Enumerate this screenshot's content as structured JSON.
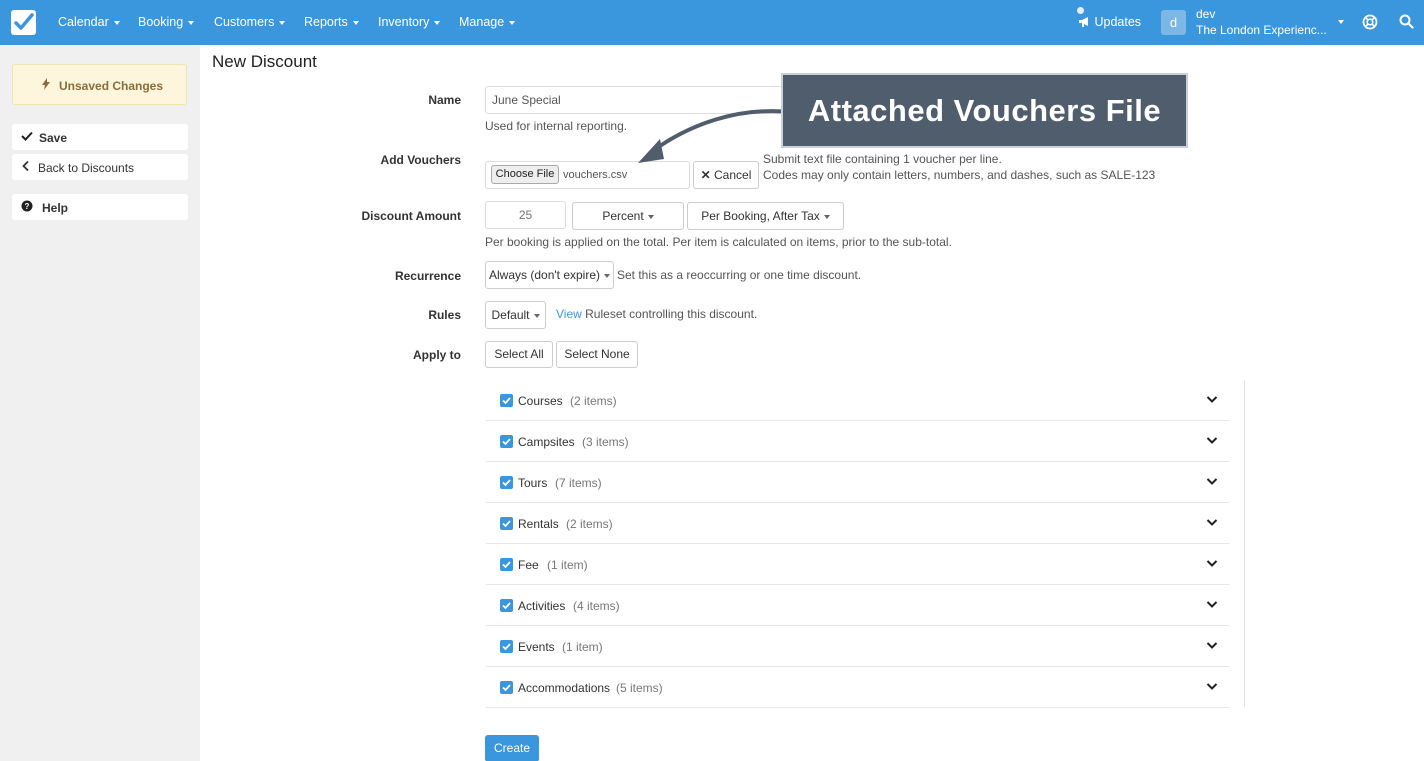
{
  "nav": {
    "items": [
      "Calendar",
      "Booking",
      "Customers",
      "Reports",
      "Inventory",
      "Manage"
    ],
    "updates_label": "Updates",
    "avatar_letter": "d",
    "user_name": "dev",
    "user_org": "The London Experienc..."
  },
  "sidebar": {
    "unsaved_label": "Unsaved Changes",
    "save_label": "Save",
    "back_label": "Back to Discounts",
    "help_label": "Help"
  },
  "page": {
    "title": "New Discount"
  },
  "form": {
    "name_label": "Name",
    "name_value": "June Special",
    "name_help": "Used for internal reporting.",
    "vouchers_label": "Add Vouchers",
    "choose_file_label": "Choose File",
    "file_name": "vouchers.csv",
    "cancel_label": "Cancel",
    "vouchers_help_1": "Submit text file containing 1 voucher per line.",
    "vouchers_help_2": "Codes may only contain letters, numbers, and dashes, such as SALE-123",
    "amount_label": "Discount Amount",
    "amount_value": "25",
    "amount_type": "Percent",
    "amount_scope": "Per Booking, After Tax",
    "amount_help": "Per booking is applied on the total. Per item is calculated on items, prior to the sub-total.",
    "recurrence_label": "Recurrence",
    "recurrence_value": "Always (don't expire)",
    "recurrence_help": "Set this as a reoccurring or one time discount.",
    "rules_label": "Rules",
    "rules_value": "Default",
    "rules_link": "View",
    "rules_help": "Ruleset controlling this discount.",
    "apply_label": "Apply to",
    "select_all_label": "Select All",
    "select_none_label": "Select None",
    "create_label": "Create"
  },
  "apply_items": [
    {
      "name": "Courses",
      "count": "(2 items)",
      "checked": true
    },
    {
      "name": "Campsites",
      "count": "(3 items)",
      "checked": true
    },
    {
      "name": "Tours",
      "count": "(7 items)",
      "checked": true
    },
    {
      "name": "Rentals",
      "count": "(2 items)",
      "checked": true
    },
    {
      "name": "Fee",
      "count": "(1 item)",
      "checked": true
    },
    {
      "name": "Activities",
      "count": "(4 items)",
      "checked": true
    },
    {
      "name": "Events",
      "count": "(1 item)",
      "checked": true
    },
    {
      "name": "Accommodations",
      "count": "(5 items)",
      "checked": true
    }
  ],
  "annotation": {
    "text": "Attached Vouchers File"
  },
  "colors": {
    "brand": "#3a96dd",
    "annotation_bg": "#505d6d",
    "unsaved_bg": "#fdf6dc"
  }
}
